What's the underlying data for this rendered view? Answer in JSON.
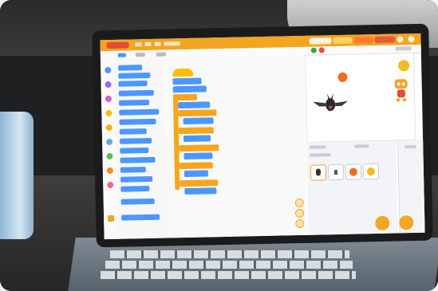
{
  "scene": "photo-of-laptop-running-block-coding-editor",
  "colors": {
    "topbar": "#f2a521",
    "block_blue": "#4c97ff",
    "block_orange": "#f7a51b",
    "flag_green": "#3aa53a",
    "stop_red": "#e84b3a"
  },
  "icons": [
    "flag-icon",
    "stop-icon",
    "fullscreen-icon",
    "ball-icon",
    "bat-sprite-icon",
    "robot-mascot-icon",
    "add-sprite-icon",
    "add-backdrop-icon",
    "zoom-in-icon",
    "zoom-out-icon",
    "reset-zoom-icon"
  ]
}
